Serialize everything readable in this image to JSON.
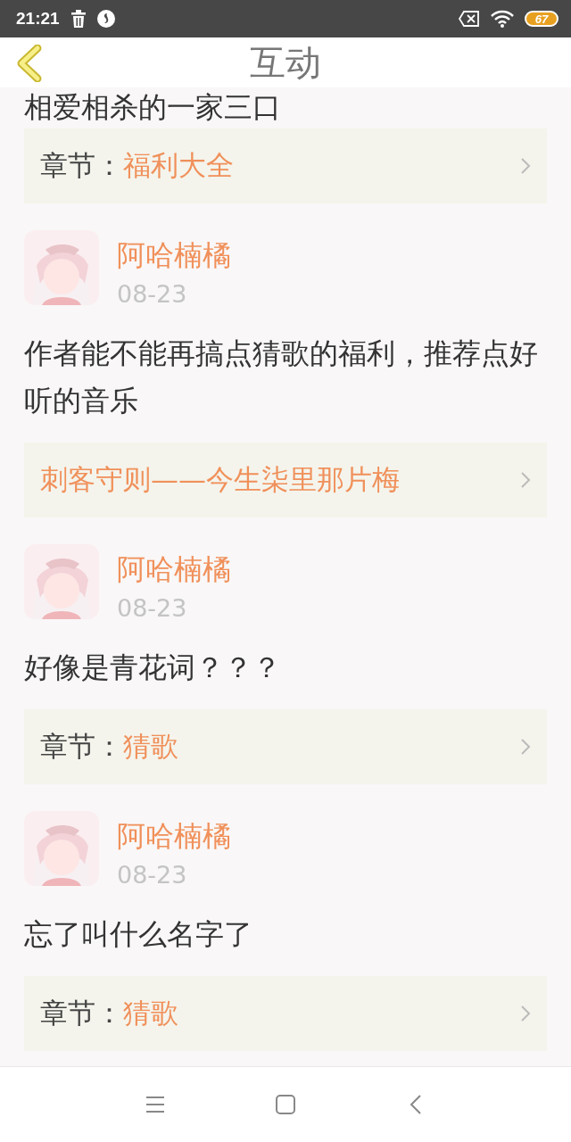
{
  "status_bar": {
    "time": "21:21",
    "battery": "67"
  },
  "header": {
    "title": "互动"
  },
  "feed": {
    "partial_text": "相爱相杀的一家三口",
    "first_link": {
      "prefix": "章节：",
      "title": "福利大全"
    },
    "comments": [
      {
        "author": "阿哈楠橘",
        "date": "08-23",
        "text": "作者能不能再搞点猜歌的福利，推荐点好听的音乐",
        "link": {
          "title": "刺客守则——今生柒里那片梅"
        }
      },
      {
        "author": "阿哈楠橘",
        "date": "08-23",
        "text": "好像是青花词？？？",
        "link": {
          "prefix": "章节：",
          "title": "猜歌"
        }
      },
      {
        "author": "阿哈楠橘",
        "date": "08-23",
        "text": "忘了叫什么名字了",
        "link": {
          "prefix": "章节：",
          "title": "猜歌"
        }
      }
    ]
  }
}
